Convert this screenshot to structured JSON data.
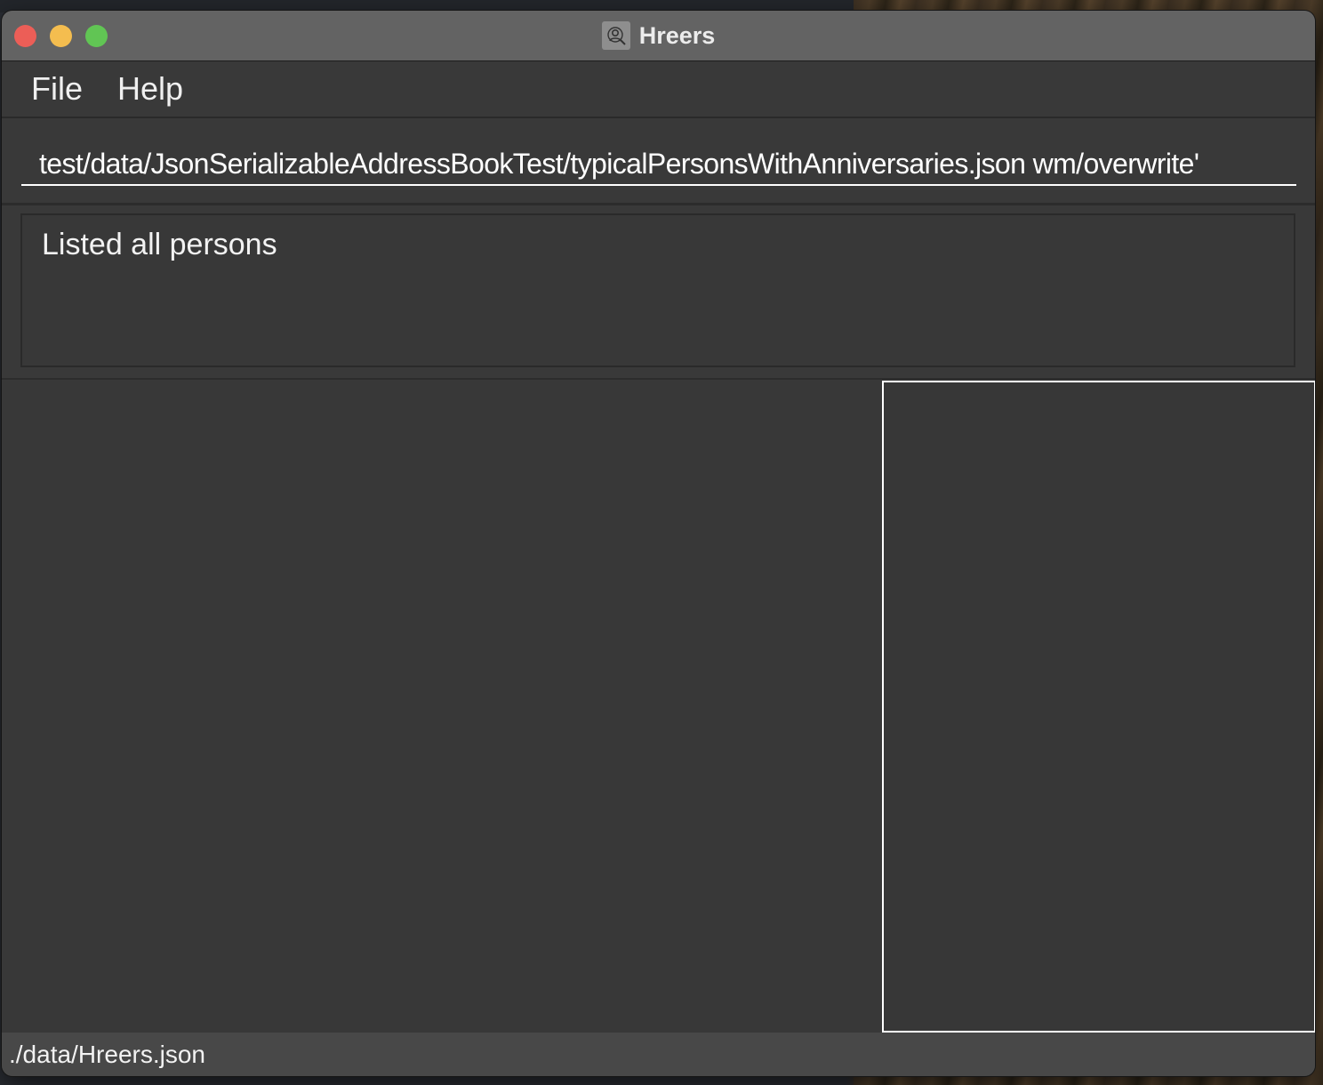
{
  "window": {
    "title": "Hreers",
    "app_icon": "person-search-icon"
  },
  "menu": {
    "items": [
      {
        "label": "File"
      },
      {
        "label": "Help"
      }
    ]
  },
  "command_box": {
    "value": "'test/data/JsonSerializableAddressBookTest/typicalPersonsWithAnniversaries.json wm/overwrite"
  },
  "result_display": {
    "text": "Listed all persons"
  },
  "status_bar": {
    "save_location": "./data/Hreers.json"
  },
  "colors": {
    "window_bg": "#373737",
    "titlebar_bg": "#636363",
    "close": "#ec5e57",
    "minimize": "#f4bd4f",
    "maximize": "#61c554",
    "text": "#ffffff"
  }
}
